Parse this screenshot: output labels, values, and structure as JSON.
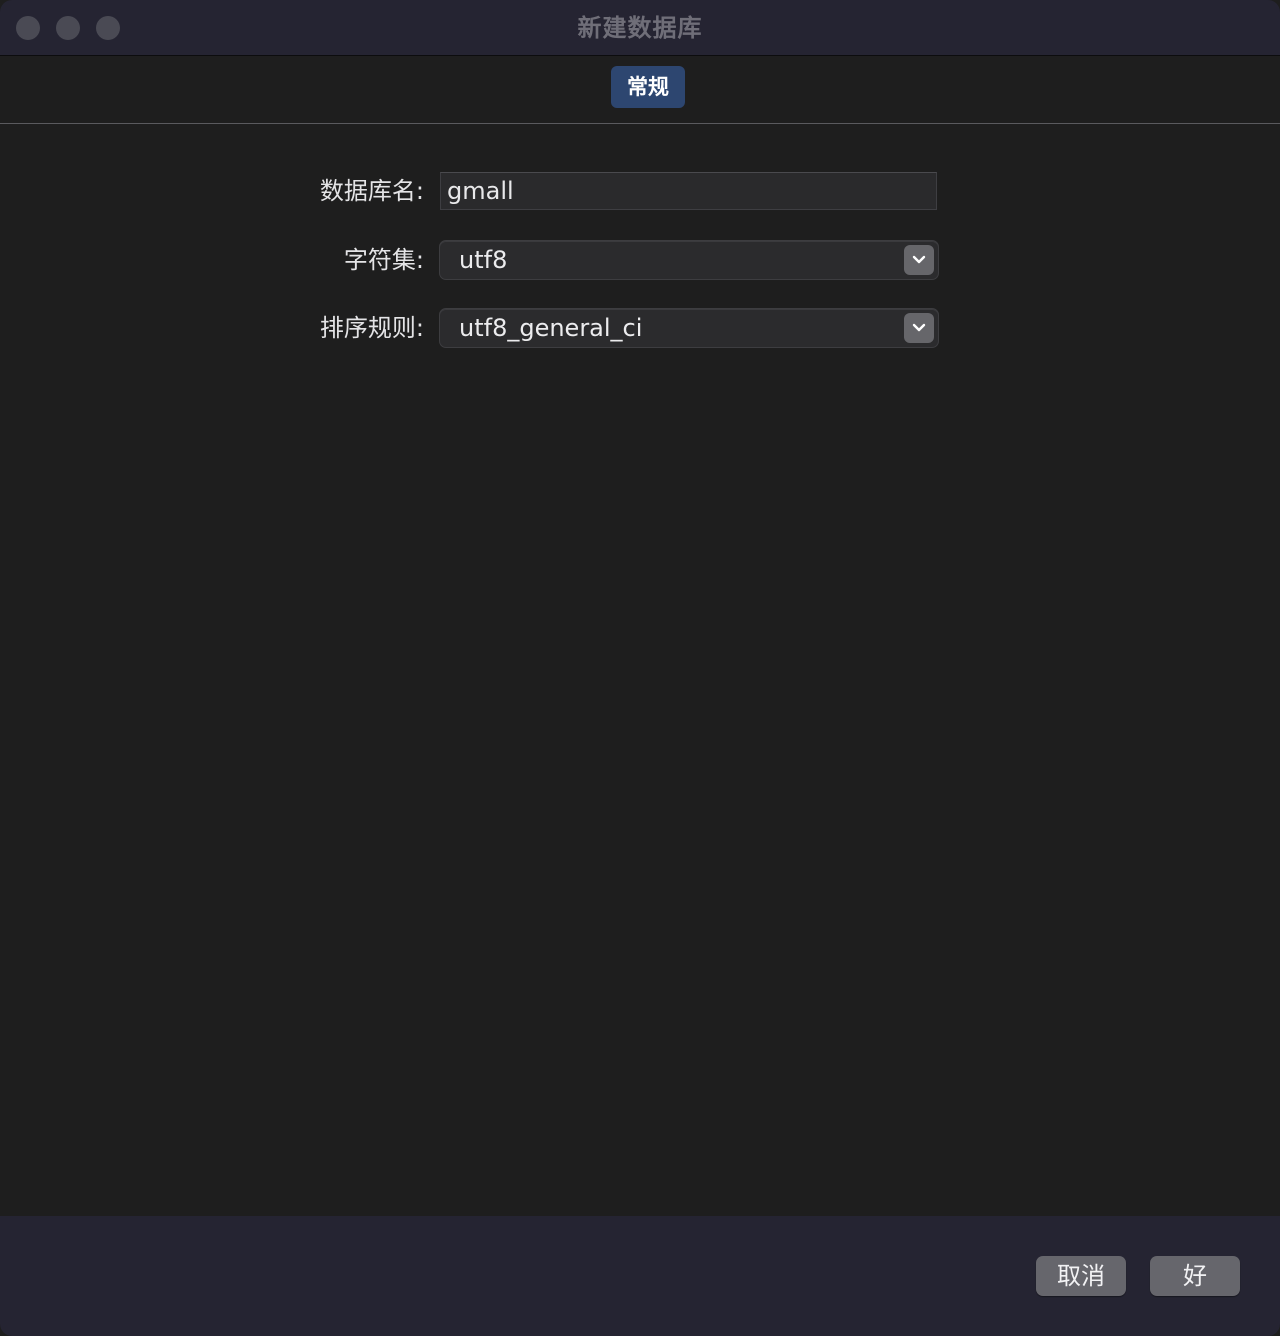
{
  "window": {
    "title": "新建数据库"
  },
  "tabs": [
    {
      "label": "常规",
      "active": true
    }
  ],
  "form": {
    "db_name": {
      "label": "数据库名:",
      "value": "gmall"
    },
    "charset": {
      "label": "字符集:",
      "value": "utf8"
    },
    "collation": {
      "label": "排序规则:",
      "value": "utf8_general_ci"
    }
  },
  "footer": {
    "cancel_label": "取消",
    "ok_label": "好"
  },
  "colors": {
    "titlebar_bg": "#252432",
    "content_bg": "#1e1e1e",
    "tab_active_bg": "#2d4670",
    "button_bg": "#66666c"
  }
}
